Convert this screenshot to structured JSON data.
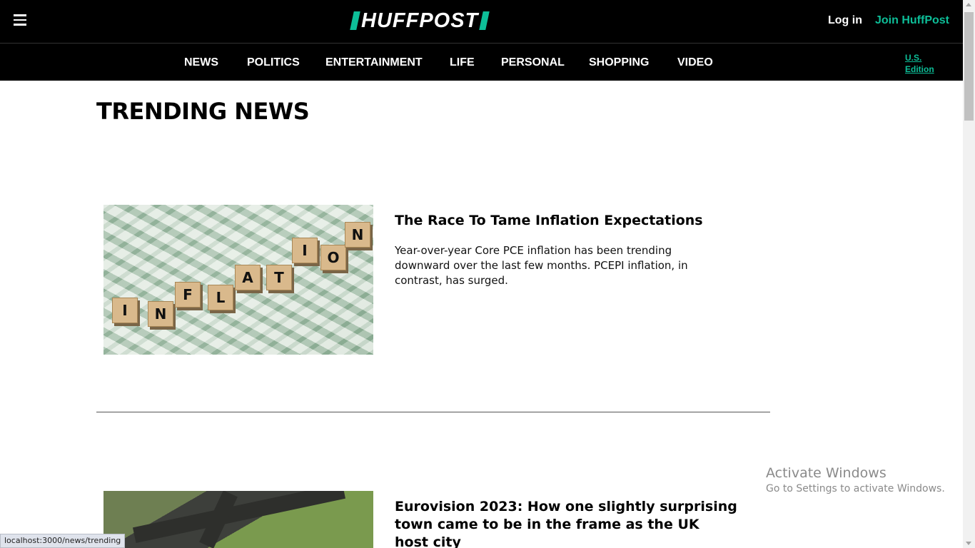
{
  "header": {
    "logo_text": "HUFFPOST",
    "login_label": "Log in",
    "join_label": "Join HuffPost",
    "brand_color": "#0dbe98"
  },
  "nav": {
    "items": [
      "NEWS",
      "POLITICS",
      "ENTERTAINMENT",
      "LIFE",
      "PERSONAL",
      "SHOPPING",
      "VIDEO"
    ],
    "edition_line1": "U.S.",
    "edition_line2": "Edition"
  },
  "main": {
    "page_title": "TRENDING NEWS",
    "articles": [
      {
        "title": "The Race To Tame Inflation Expectations",
        "description": "Year-over-year Core PCE inflation has been trending downward over the last few months. PCEPI inflation, in contrast, has surged.",
        "image_letters": [
          "I",
          "N",
          "F",
          "L",
          "A",
          "T",
          "I",
          "O",
          "N"
        ]
      },
      {
        "title": "Eurovision 2023: How one slightly surprising town came to be in the frame as the UK host city"
      }
    ]
  },
  "overlay": {
    "activate_title": "Activate Windows",
    "activate_sub": "Go to Settings to activate Windows."
  },
  "status": {
    "url": "localhost:3000/news/trending"
  }
}
